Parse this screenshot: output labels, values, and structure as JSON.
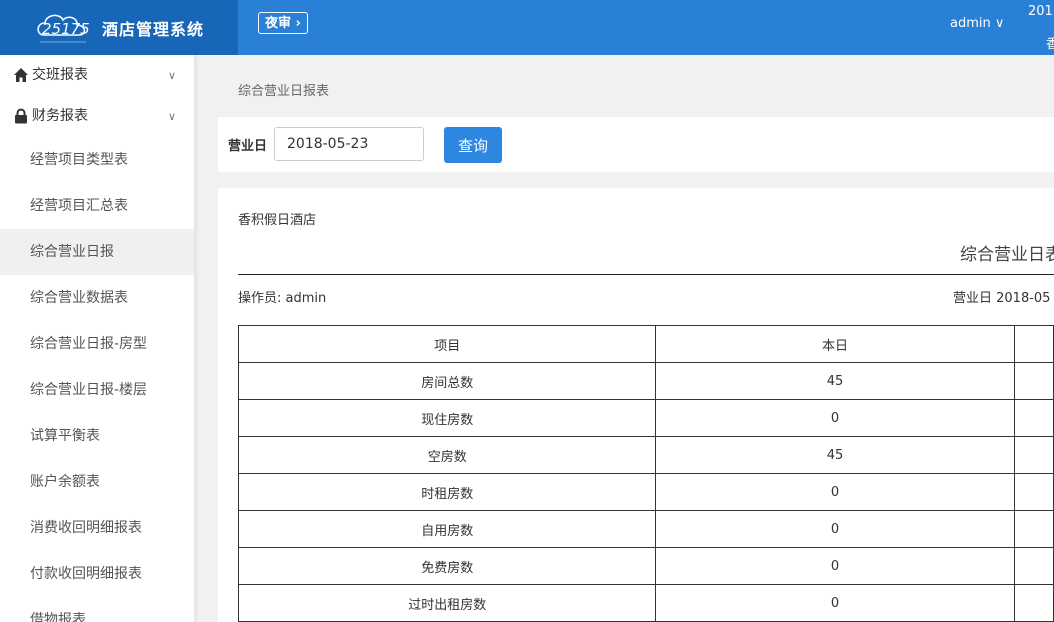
{
  "header": {
    "brand_title": "酒店管理系统",
    "night_audit": "夜审 ›",
    "user": "admin ∨",
    "top_right_line1": "201",
    "top_right_line2": "香"
  },
  "sidebar": {
    "sections": [
      {
        "label": "交班报表",
        "icon": "home-icon"
      },
      {
        "label": "财务报表",
        "icon": "lock-icon"
      }
    ],
    "items": [
      {
        "label": "经营项目类型表"
      },
      {
        "label": "经营项目汇总表"
      },
      {
        "label": "综合营业日报"
      },
      {
        "label": "综合营业数据表"
      },
      {
        "label": "综合营业日报-房型"
      },
      {
        "label": "综合营业日报-楼层"
      },
      {
        "label": "试算平衡表"
      },
      {
        "label": "账户余额表"
      },
      {
        "label": "消费收回明细报表"
      },
      {
        "label": "付款收回明细报表"
      },
      {
        "label": "借物报表"
      }
    ],
    "active_index": 2
  },
  "breadcrumb": "综合营业日报表",
  "query": {
    "label": "营业日",
    "date_value": "2018-05-23",
    "button": "查询"
  },
  "report": {
    "hotel": "香积假日酒店",
    "title": "综合营业日表",
    "operator": "操作员: admin",
    "business_date": "营业日 2018-05",
    "columns": [
      "项目",
      "本日",
      ""
    ],
    "rows": [
      {
        "item": "房间总数",
        "today": "45"
      },
      {
        "item": "现住房数",
        "today": "0"
      },
      {
        "item": "空房数",
        "today": "45"
      },
      {
        "item": "时租房数",
        "today": "0"
      },
      {
        "item": "自用房数",
        "today": "0"
      },
      {
        "item": "免费房数",
        "today": "0"
      },
      {
        "item": "过时出租房数",
        "today": "0"
      }
    ]
  },
  "colors": {
    "header_blue": "#2a7fd6",
    "brand_blue": "#1766b8",
    "button_blue": "#2d87e0"
  }
}
